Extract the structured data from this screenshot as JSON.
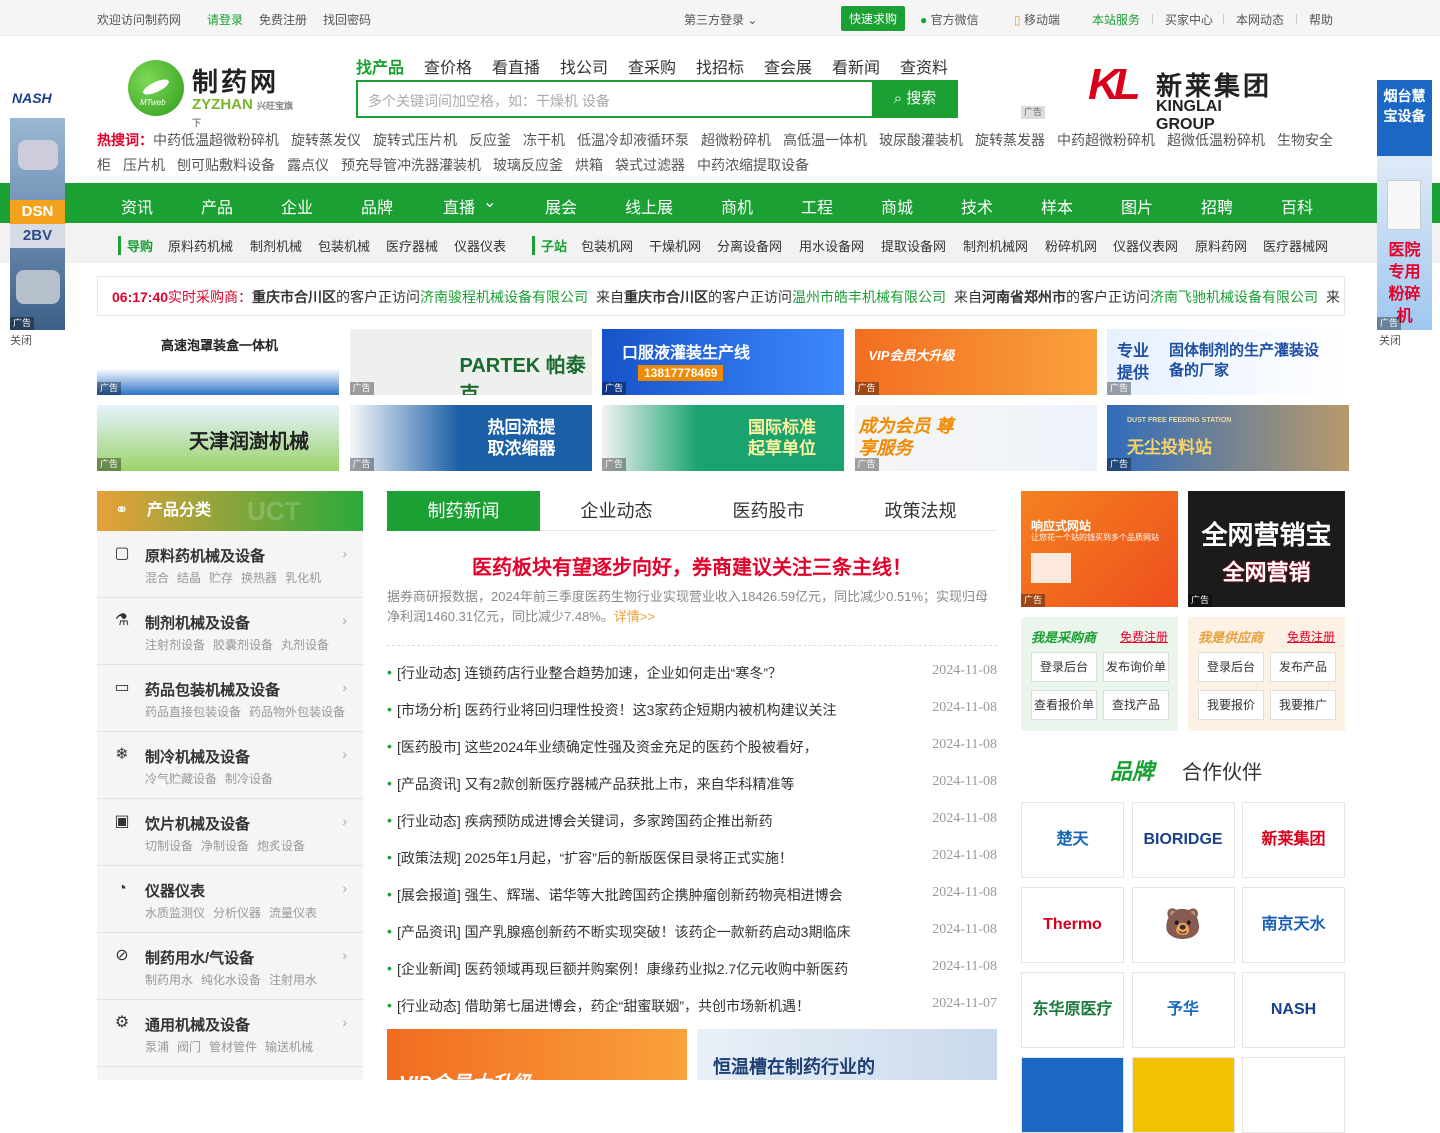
{
  "topbar": {
    "welcome": "欢迎访问制药网",
    "login": "请登录",
    "register": "免费注册",
    "recover": "找回密码",
    "third_party": "第三方登录",
    "quick_buy": "快速求购",
    "wechat": "官方微信",
    "mobile": "移动端",
    "service": "本站服务",
    "buyer": "买家中心",
    "news": "本网动态",
    "help": "帮助"
  },
  "logo": {
    "name": "制药网",
    "sub": "ZYZHAN",
    "badge": "MTweb",
    "tagline": "兴旺宝旗下"
  },
  "search": {
    "tabs": [
      "找产品",
      "查价格",
      "看直播",
      "找公司",
      "查采购",
      "找招标",
      "查会展",
      "看新闻",
      "查资料"
    ],
    "placeholder": "多个关键词间加空格，如：干燥机 设备",
    "button": "搜索"
  },
  "kinglai": {
    "cn": "新莱集团",
    "en": "KINGLAI GROUP"
  },
  "ad_label": "广告",
  "hot": {
    "label": "热搜词：",
    "words": [
      "中药低温超微粉碎机",
      "旋转蒸发仪",
      "旋转式压片机",
      "反应釜",
      "冻干机",
      "低温冷却液循环泵",
      "超微粉碎机",
      "高低温一体机",
      "玻尿酸灌装机",
      "旋转蒸发器",
      "中药超微粉碎机",
      "超微低温粉碎机",
      "生物安全柜",
      "压片机",
      "刨可贴敷料设备",
      "露点仪",
      "预充导管冲洗器灌装机",
      "玻璃反应釜",
      "烘箱",
      "袋式过滤器",
      "中药浓缩提取设备"
    ]
  },
  "nav": [
    "资讯",
    "产品",
    "企业",
    "品牌",
    "直播",
    "展会",
    "线上展",
    "商机",
    "工程",
    "商城",
    "技术",
    "样本",
    "图片",
    "招聘",
    "百科"
  ],
  "subnav": {
    "guide_label": "导购",
    "guide": [
      "原料药机械",
      "制剂机械",
      "包装机械",
      "医疗器械",
      "仪器仪表"
    ],
    "site_label": "子站",
    "sites": [
      "包装机网",
      "干燥机网",
      "分离设备网",
      "用水设备网",
      "提取设备网",
      "制剂机械网",
      "粉碎机网",
      "仪器仪表网",
      "原料药网",
      "医疗器械网"
    ]
  },
  "ticker": {
    "time": "06:17:40",
    "label": "实时采购商：",
    "items": [
      {
        "prefix": "",
        "place": "重庆市合川区",
        "mid": "的客户正访问",
        "company": "济南骏程机械设备有限公司"
      },
      {
        "prefix": "来自",
        "place": "重庆市合川区",
        "mid": "的客户正访问",
        "company": "温州市皓丰机械有限公司"
      },
      {
        "prefix": "来自",
        "place": "河南省郑州市",
        "mid": "的客户正访问",
        "company": "济南飞驰机械设备有限公司"
      },
      {
        "prefix": "来",
        "place": "",
        "mid": "",
        "company": ""
      }
    ]
  },
  "banners": [
    {
      "text": "高速泡罩装盒一体机"
    },
    {
      "text": "PARTEK 帕泰克"
    },
    {
      "text": "口服液灌装生产线",
      "phone": "13817778469"
    },
    {
      "text": "VIP会员大升级"
    },
    {
      "text": "专业提供",
      "text2": "固体制剂的生产灌装设备的厂家"
    },
    {
      "text": "天津润澍机械"
    },
    {
      "text": "热回流提取浓缩器"
    },
    {
      "text": "国际标准起草单位"
    },
    {
      "text": "成为会员 尊享服务"
    },
    {
      "text": "无尘投料站",
      "text2": "DUST FREE FEEDING STATION"
    }
  ],
  "side_left": {
    "brand": "NASH",
    "m1": "DSN",
    "m2": "2BV",
    "close": "关闭"
  },
  "side_right": {
    "t1": "烟台慧宝设备",
    "t2": "医院专用粉碎机",
    "close": "关闭"
  },
  "categories": {
    "title": "产品分类",
    "items": [
      {
        "name": "原料药机械及设备",
        "subs": [
          "混合",
          "结晶",
          "贮存",
          "换热器",
          "乳化机"
        ]
      },
      {
        "name": "制剂机械及设备",
        "subs": [
          "注射剂设备",
          "胶囊剂设备",
          "丸剂设备"
        ]
      },
      {
        "name": "药品包装机械及设备",
        "subs": [
          "药品直接包装设备",
          "药品物外包装设备"
        ]
      },
      {
        "name": "制冷机械及设备",
        "subs": [
          "冷气贮藏设备",
          "制冷设备"
        ]
      },
      {
        "name": "饮片机械及设备",
        "subs": [
          "切制设备",
          "净制设备",
          "炮炙设备"
        ]
      },
      {
        "name": "仪器仪表",
        "subs": [
          "水质监测仪",
          "分析仪器",
          "流量仪表"
        ]
      },
      {
        "name": "制药用水/气设备",
        "subs": [
          "制药用水",
          "纯化水设备",
          "注射用水"
        ]
      },
      {
        "name": "通用机械及设备",
        "subs": [
          "泵浦",
          "阀门",
          "管材管件",
          "输送机械"
        ]
      }
    ]
  },
  "news": {
    "tabs": [
      "制药新闻",
      "企业动态",
      "医药股市",
      "政策法规"
    ],
    "headline": "医药板块有望逐步向好，券商建议关注三条主线！",
    "summary": "据券商研报数据，2024年前三季度医药生物行业实现营业收入18426.59亿元，同比减少0.51%；实现归母净利润1460.31亿元，同比减少7.48%。",
    "more": "详情>>",
    "items": [
      {
        "title": "[行业动态] 连锁药店行业整合趋势加速，企业如何走出“寒冬”？",
        "date": "2024-11-08"
      },
      {
        "title": "[市场分析] 医药行业将回归理性投资！这3家药企短期内被机构建议关注",
        "date": "2024-11-08"
      },
      {
        "title": "[医药股市] 这些2024年业绩确定性强及资金充足的医药个股被看好，",
        "date": "2024-11-08"
      },
      {
        "title": "[产品资讯] 又有2款创新医疗器械产品获批上市，来自华科精准等",
        "date": "2024-11-08"
      },
      {
        "title": "[行业动态] 疾病预防成进博会关键词，多家跨国药企推出新药",
        "date": "2024-11-08"
      },
      {
        "title": "[政策法规] 2025年1月起，“扩容”后的新版医保目录将正式实施！",
        "date": "2024-11-08"
      },
      {
        "title": "[展会报道] 强生、辉瑞、诺华等大批跨国药企携肿瘤创新药物亮相进博会",
        "date": "2024-11-08"
      },
      {
        "title": "[产品资讯] 国产乳腺癌创新药不断实现突破！该药企一款新药启动3期临床",
        "date": "2024-11-08"
      },
      {
        "title": "[企业新闻] 医药领域再现巨额并购案例！康缘药业拟2.7亿元收购中新医药",
        "date": "2024-11-08"
      },
      {
        "title": "[行业动态] 借助第七届进博会，药企“甜蜜联姻”，共创市场新机遇！",
        "date": "2024-11-07"
      }
    ],
    "bottom_ads": [
      "VIP会员大升级",
      "恒温槽在制药行业的"
    ]
  },
  "right": {
    "ad1": {
      "title": "响应式网站",
      "sub": "让您花一个站的钱买到多个品质网站"
    },
    "ad2": {
      "t1": "全网营销宝",
      "t2": "全网营销"
    },
    "buyer": {
      "title": "我是采购商",
      "reg": "免费注册",
      "btns": [
        "登录后台",
        "发布询价单",
        "查看报价单",
        "查找产品"
      ]
    },
    "supplier": {
      "title": "我是供应商",
      "reg": "免费注册",
      "btns": [
        "登录后台",
        "发布产品",
        "我要报价",
        "我要推广"
      ]
    },
    "brand_title": "品牌",
    "brand_title2": "合作伙伴",
    "brands": [
      "楚天",
      "BIORIDGE",
      "新莱集团",
      "Thermo Fisher",
      "",
      "南京天水",
      "东华原医疗",
      "予华",
      "NASH"
    ]
  },
  "colors": {
    "primary": "#1aa033",
    "red": "#e4002b",
    "orange": "#e8a03a"
  }
}
